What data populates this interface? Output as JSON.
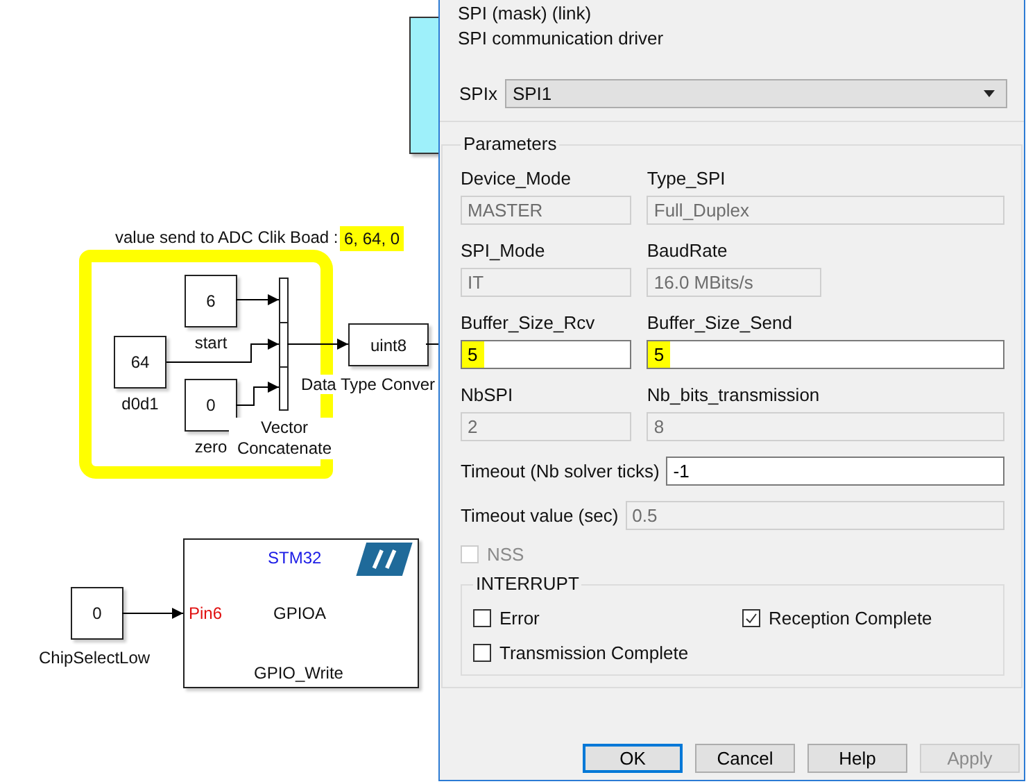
{
  "diagram": {
    "annotation": {
      "text": "value send to ADC Clik Boad :",
      "highlight": "6, 64, 0"
    },
    "constants": [
      {
        "value": "6",
        "label": "start"
      },
      {
        "value": "64",
        "label": "d0d1"
      },
      {
        "value": "0",
        "label": "zero"
      }
    ],
    "concatenate": {
      "label": "Vector Concatenate"
    },
    "converter": {
      "value": "uint8",
      "label": "Data Type Conver"
    },
    "chip_select": {
      "value": "0",
      "label": "ChipSelectLow"
    },
    "gpio_block": {
      "title": "STM32",
      "port": "Pin6",
      "name": "GPIOA",
      "function": "GPIO_Write"
    }
  },
  "dialog": {
    "title": "SPI (mask) (link)",
    "description": "SPI communication driver",
    "spix": {
      "label": "SPIx",
      "value": "SPI1"
    },
    "parameters": {
      "title": "Parameters",
      "pairs": [
        [
          {
            "label": "Device_Mode",
            "value": "MASTER",
            "disabled": true,
            "highlighted": false
          },
          {
            "label": "Type_SPI",
            "value": "Full_Duplex",
            "disabled": true,
            "highlighted": false
          }
        ],
        [
          {
            "label": "SPI_Mode",
            "value": "IT",
            "disabled": true,
            "highlighted": false
          },
          {
            "label": "BaudRate",
            "value": "16.0 MBits/s",
            "disabled": true,
            "highlighted": false
          }
        ],
        [
          {
            "label": "Buffer_Size_Rcv",
            "value": "5",
            "disabled": false,
            "highlighted": true
          },
          {
            "label": "Buffer_Size_Send",
            "value": "5",
            "disabled": false,
            "highlighted": true
          }
        ],
        [
          {
            "label": "NbSPI",
            "value": "2",
            "disabled": true,
            "highlighted": false
          },
          {
            "label": "Nb_bits_transmission",
            "value": "8",
            "disabled": true,
            "highlighted": false
          }
        ]
      ],
      "inline": [
        {
          "label": "Timeout (Nb solver ticks)",
          "value": "-1",
          "disabled": false
        },
        {
          "label": "Timeout value (sec)",
          "value": "0.5",
          "disabled": true
        }
      ],
      "nss": {
        "label": "NSS",
        "checked": false,
        "disabled": true
      },
      "interrupt": {
        "title": "INTERRUPT",
        "options": [
          {
            "label": "Error",
            "checked": false
          },
          {
            "label": "Reception Complete",
            "checked": true
          },
          {
            "label": "Transmission Complete",
            "checked": false
          }
        ]
      }
    },
    "buttons": [
      {
        "label": "OK",
        "focused": true,
        "disabled": false
      },
      {
        "label": "Cancel",
        "focused": false,
        "disabled": false
      },
      {
        "label": "Help",
        "focused": false,
        "disabled": false
      },
      {
        "label": "Apply",
        "focused": false,
        "disabled": true
      }
    ]
  }
}
